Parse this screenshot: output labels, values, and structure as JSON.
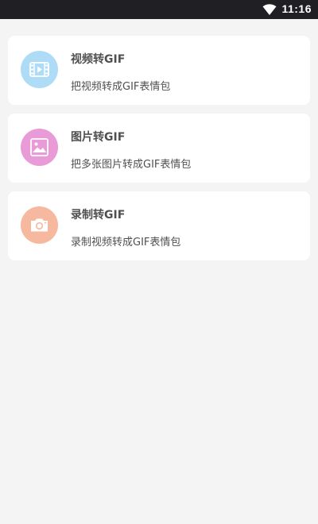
{
  "status_bar": {
    "time": "11:16",
    "wifi_icon": "wifi-icon"
  },
  "items": [
    {
      "title": "视频转GIF",
      "description": "把视频转成GIF表情包",
      "icon": "video-icon",
      "icon_bg": "#aedcf6"
    },
    {
      "title": "图片转GIF",
      "description": "把多张图片转成GIF表情包",
      "icon": "image-icon",
      "icon_bg": "#e89bd7"
    },
    {
      "title": "录制转GIF",
      "description": "录制视频转成GIF表情包",
      "icon": "camera-icon",
      "icon_bg": "#f7b8a0"
    }
  ]
}
